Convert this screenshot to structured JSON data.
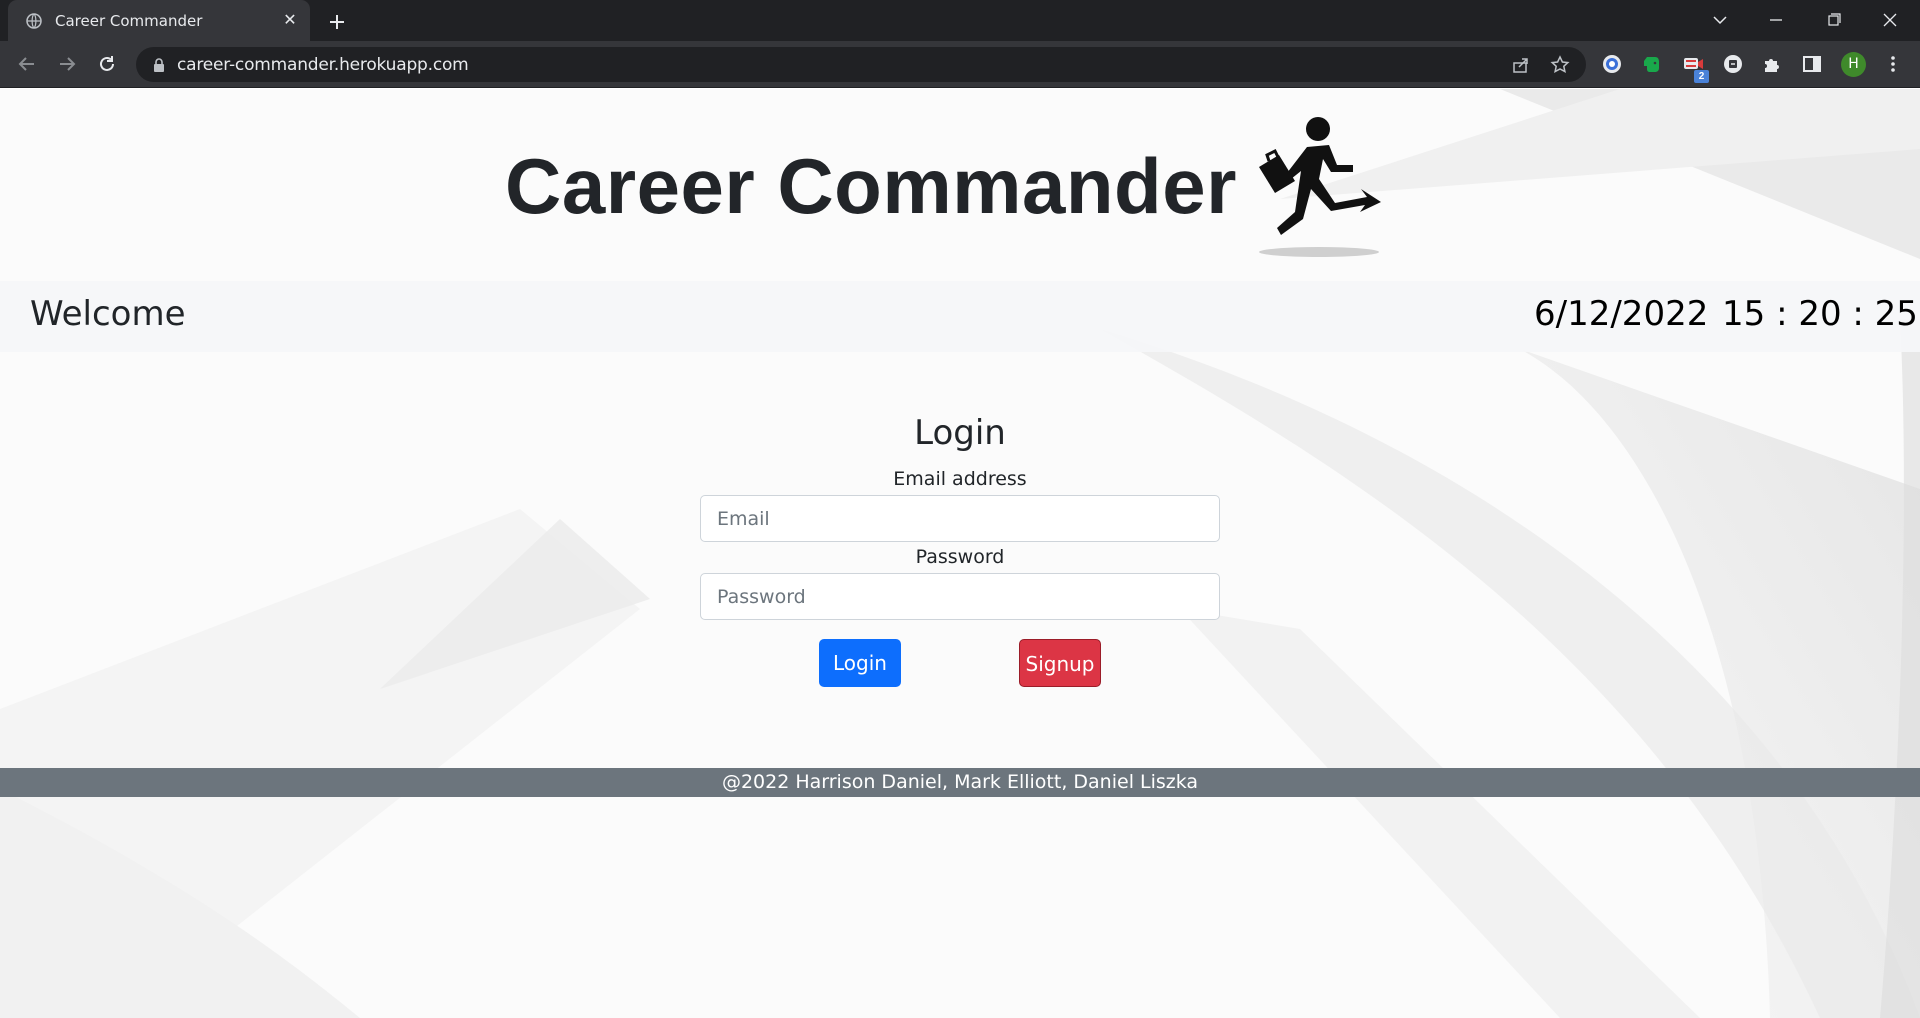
{
  "browser": {
    "tab_title": "Career Commander",
    "url": "career-commander.herokuapp.com",
    "profile_initial": "H",
    "extension_badge": "2"
  },
  "header": {
    "title": "Career Commander",
    "logo_icon": "running-businessman-icon"
  },
  "welcome_bar": {
    "welcome": "Welcome",
    "date": "6/12/2022",
    "time": "15 : 20 : 25"
  },
  "login_form": {
    "heading": "Login",
    "email_label": "Email address",
    "email_placeholder": "Email",
    "password_label": "Password",
    "password_placeholder": "Password",
    "login_button": "Login",
    "signup_button": "Signup"
  },
  "footer": {
    "text": "@2022 Harrison Daniel, Mark Elliott, Daniel Liszka"
  },
  "colors": {
    "primary": "#0d6efd",
    "danger": "#dc3545",
    "footer_bg": "#6c757d"
  }
}
